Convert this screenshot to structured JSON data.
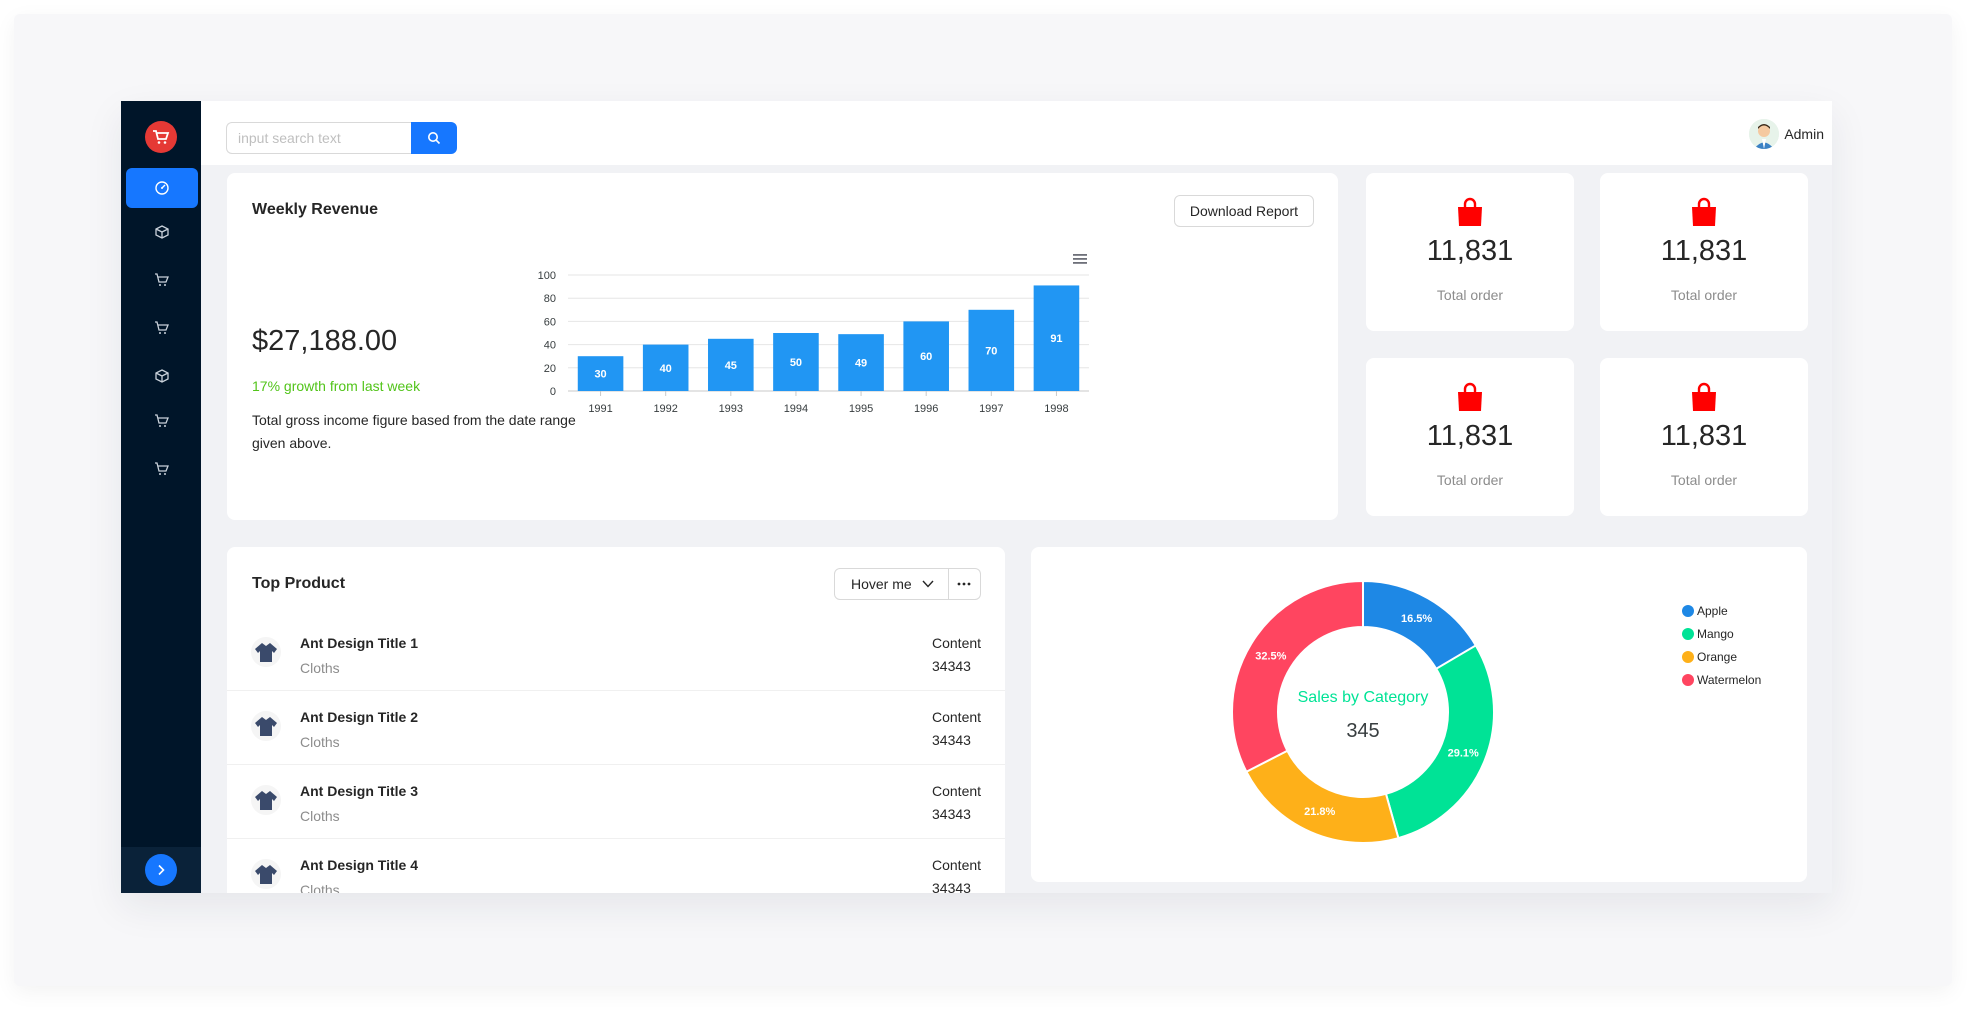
{
  "sidebar": {
    "logo_icon": "shopping-cart-icon",
    "items": [
      {
        "icon": "dashboard-icon",
        "active": true
      },
      {
        "icon": "cube-icon",
        "active": false
      },
      {
        "icon": "cart-icon",
        "active": false
      },
      {
        "icon": "cart-icon",
        "active": false
      },
      {
        "icon": "cube-icon",
        "active": false
      },
      {
        "icon": "cart-icon",
        "active": false
      },
      {
        "icon": "cart-icon",
        "active": false
      }
    ],
    "collapse_icon": "chevron-right-icon"
  },
  "header": {
    "search_placeholder": "input search text",
    "search_value": "",
    "user_name": "Admin"
  },
  "revenue": {
    "title": "Weekly Revenue",
    "download_label": "Download Report",
    "amount": "$27,188.00",
    "growth": "17% growth from last week",
    "description": "Total gross income figure based from the date range given above."
  },
  "stats": [
    {
      "value": "11,831",
      "label": "Total order"
    },
    {
      "value": "11,831",
      "label": "Total order"
    },
    {
      "value": "11,831",
      "label": "Total order"
    },
    {
      "value": "11,831",
      "label": "Total order"
    }
  ],
  "products": {
    "title": "Top Product",
    "dropdown_label": "Hover me",
    "items": [
      {
        "title": "Ant Design Title 1",
        "subtitle": "Cloths",
        "content_label": "Content",
        "content_value": "34343"
      },
      {
        "title": "Ant Design Title 2",
        "subtitle": "Cloths",
        "content_label": "Content",
        "content_value": "34343"
      },
      {
        "title": "Ant Design Title 3",
        "subtitle": "Cloths",
        "content_label": "Content",
        "content_value": "34343"
      },
      {
        "title": "Ant Design Title 4",
        "subtitle": "Cloths",
        "content_label": "Content",
        "content_value": "34343"
      }
    ]
  },
  "colors": {
    "primary": "#1677ff",
    "sidebar": "#001529",
    "growth": "#52c41a",
    "bag": "#ff0000",
    "bar": "#2196f3"
  },
  "chart_data": [
    {
      "type": "bar",
      "categories": [
        "1991",
        "1992",
        "1993",
        "1994",
        "1995",
        "1996",
        "1997",
        "1998"
      ],
      "values": [
        30,
        40,
        45,
        50,
        49,
        60,
        70,
        91
      ],
      "ylim": [
        0,
        100
      ],
      "yticks": [
        0,
        20,
        40,
        60,
        80,
        100
      ],
      "data_labels": true,
      "grid": true,
      "color": "#2196f3"
    },
    {
      "type": "pie",
      "donut": true,
      "center_label": "Sales by Category",
      "center_value": "345",
      "labels": [
        "Apple",
        "Mango",
        "Orange",
        "Watermelon"
      ],
      "values": [
        16.5,
        29.1,
        21.8,
        32.5
      ],
      "slice_labels": [
        "16.5%",
        "29.1%",
        "21.8%",
        "32.5%"
      ],
      "colors": [
        "#1e88e5",
        "#00e396",
        "#feb019",
        "#ff4560"
      ],
      "legend_position": "top-right"
    }
  ]
}
